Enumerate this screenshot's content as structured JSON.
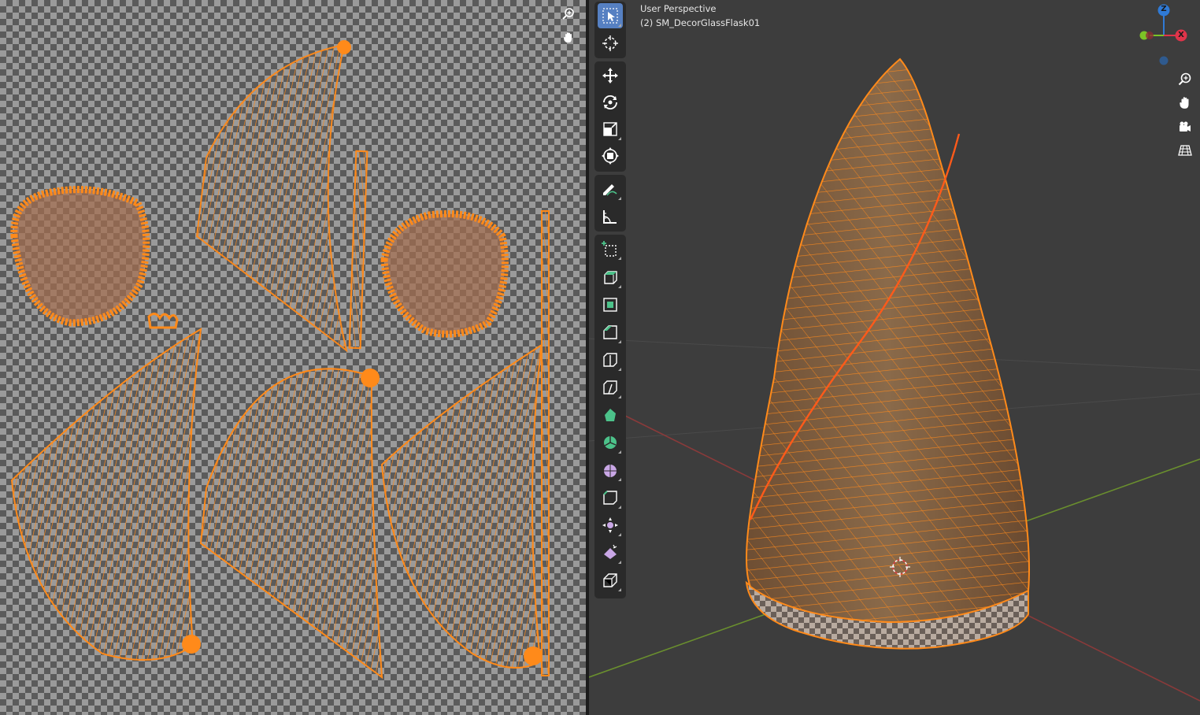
{
  "viewport": {
    "perspective_label": "User Perspective",
    "object_label": "(2) SM_DecorGlassFlask01",
    "gizmo": {
      "z": "Z",
      "x": "X"
    }
  },
  "uv_editor": {
    "nav": [
      {
        "name": "zoom-icon"
      },
      {
        "name": "hand-pan-icon"
      }
    ]
  },
  "toolbar": {
    "tools": [
      {
        "name": "select-box-tool",
        "icon": "cursor-box",
        "active": true
      },
      {
        "name": "cursor-tool",
        "icon": "3d-cursor"
      },
      {
        "name": "move-tool",
        "icon": "move-arrows"
      },
      {
        "name": "rotate-tool",
        "icon": "rotate"
      },
      {
        "name": "scale-tool",
        "icon": "scale"
      },
      {
        "name": "transform-tool",
        "icon": "transform"
      },
      {
        "name": "annotate-tool",
        "icon": "pencil"
      },
      {
        "name": "measure-tool",
        "icon": "ruler"
      },
      {
        "name": "add-cube-tool",
        "icon": "add-cube"
      },
      {
        "name": "extrude-tool",
        "icon": "extrude"
      },
      {
        "name": "inset-tool",
        "icon": "inset"
      },
      {
        "name": "bevel-tool",
        "icon": "bevel"
      },
      {
        "name": "loop-cut-tool",
        "icon": "loop-cut"
      },
      {
        "name": "knife-tool",
        "icon": "knife"
      },
      {
        "name": "poly-build-tool",
        "icon": "poly-build"
      },
      {
        "name": "spin-tool",
        "icon": "spin"
      },
      {
        "name": "smooth-tool",
        "icon": "smooth"
      },
      {
        "name": "edge-slide-tool",
        "icon": "edge-slide"
      },
      {
        "name": "shrink-fatten-tool",
        "icon": "shrink"
      },
      {
        "name": "shear-tool",
        "icon": "shear"
      },
      {
        "name": "rip-tool",
        "icon": "rip"
      }
    ]
  },
  "viewport_nav": [
    {
      "name": "zoom-icon"
    },
    {
      "name": "hand-pan-icon"
    },
    {
      "name": "camera-icon"
    },
    {
      "name": "grid-perspective-icon"
    }
  ],
  "colors": {
    "selection": "#ff8a1a",
    "active_tool": "#5680c2",
    "axis_x": "#e0344a",
    "axis_y": "#7cc226",
    "axis_z": "#2f7ad6"
  }
}
